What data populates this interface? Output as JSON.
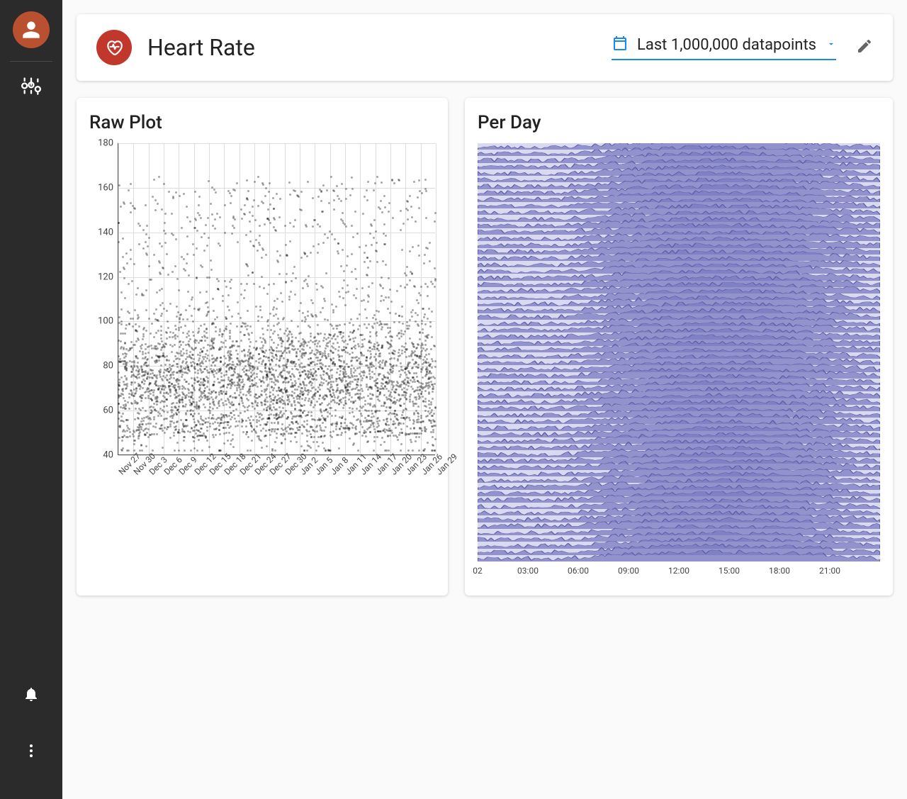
{
  "sidebar": {
    "avatar_alt": "user",
    "settings_alt": "settings",
    "bell_alt": "notifications",
    "more_alt": "more"
  },
  "header": {
    "title": "Heart Rate",
    "icon_name": "heart-rate-icon",
    "range_label": "Last 1,000,000 datapoints",
    "edit_alt": "edit"
  },
  "raw": {
    "title": "Raw Plot"
  },
  "perday": {
    "title": "Per Day"
  },
  "chart_data": [
    {
      "type": "scatter",
      "name": "raw",
      "ylim": [
        40,
        180
      ],
      "yticks": [
        40,
        60,
        80,
        100,
        120,
        140,
        160,
        180
      ],
      "x_categories": [
        "Nov 27",
        "Nov 30",
        "Dec 3",
        "Dec 6",
        "Dec 9",
        "Dec 12",
        "Dec 15",
        "Dec 18",
        "Dec 21",
        "Dec 24",
        "Dec 27",
        "Dec 30",
        "Jan 2",
        "Jan 5",
        "Jan 8",
        "Jan 11",
        "Jan 14",
        "Jan 17",
        "Jan 20",
        "Jan 23",
        "Jan 26",
        "Jan 29"
      ],
      "approx_points_per_day": 1500,
      "note": "dense scatter of heart-rate BPM readings ~Nov 27–Jan 31; values concentrate 50–100 with sparse outliers up to ~170"
    },
    {
      "type": "ridgeline",
      "name": "per-day",
      "x_ticks": [
        "02",
        "03:00",
        "06:00",
        "09:00",
        "12:00",
        "15:00",
        "18:00",
        "21:00"
      ],
      "rows": 64,
      "note": "one horizon/area strip per calendar day, x = time of day 00:00–24:00, height encodes HR; values typically dip overnight and rise afternoon/evening"
    }
  ]
}
